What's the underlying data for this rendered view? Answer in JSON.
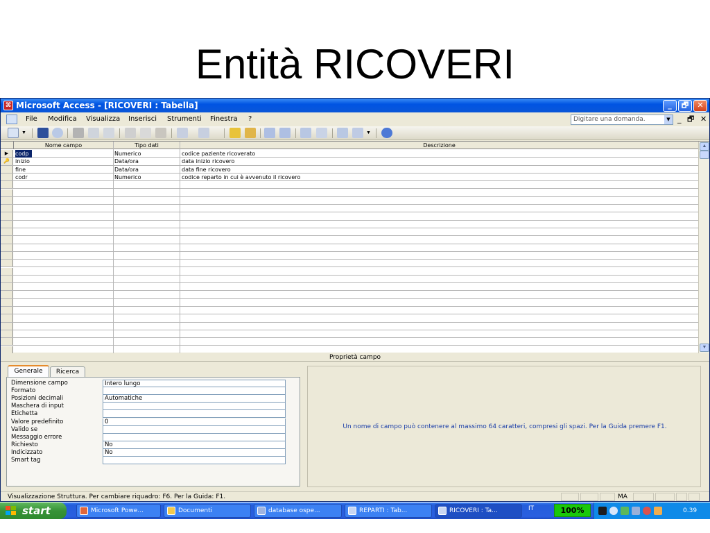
{
  "slide": {
    "title": "Entità RICOVERI"
  },
  "window": {
    "title": "Microsoft Access - [RICOVERI : Tabella]",
    "app_icon": "access-icon",
    "controls": [
      "_",
      "🗗",
      "✕"
    ]
  },
  "menubar": {
    "items": [
      "File",
      "Modifica",
      "Visualizza",
      "Inserisci",
      "Strumenti",
      "Finestra",
      "?"
    ],
    "help_placeholder": "Digitare una domanda.",
    "mdi_controls": [
      "_",
      "🗗",
      "✕"
    ]
  },
  "toolbar": {
    "icons": [
      "view-icon",
      "save-icon",
      "search-icon",
      "print-icon",
      "print-preview-icon",
      "spelling-icon",
      "cut-icon",
      "copy-icon",
      "paste-icon",
      "undo-icon",
      "redo-icon",
      "primary-key-icon",
      "indexes-icon",
      "insert-rows-icon",
      "delete-rows-icon",
      "properties-icon",
      "build-icon",
      "database-window-icon",
      "new-object-icon",
      "help-icon"
    ]
  },
  "grid": {
    "headers": [
      "Nome campo",
      "Tipo dati",
      "Descrizione"
    ],
    "rows": [
      {
        "selector": "▶",
        "name": "codp",
        "type": "Numerico",
        "description": "codice paziente ricoverato"
      },
      {
        "selector": "🔑",
        "name": "inizio",
        "type": "Data/ora",
        "description": "data inizio ricovero"
      },
      {
        "selector": "",
        "name": "fine",
        "type": "Data/ora",
        "description": "data fine ricovero"
      },
      {
        "selector": "",
        "name": "codr",
        "type": "Numerico",
        "description": "codice reparto in cui è avvenuto il ricovero"
      }
    ]
  },
  "properties": {
    "caption": "Proprietà campo",
    "tabs": [
      "Generale",
      "Ricerca"
    ],
    "fields": [
      {
        "label": "Dimensione campo",
        "value": "Intero lungo"
      },
      {
        "label": "Formato",
        "value": ""
      },
      {
        "label": "Posizioni decimali",
        "value": "Automatiche"
      },
      {
        "label": "Maschera di input",
        "value": ""
      },
      {
        "label": "Etichetta",
        "value": ""
      },
      {
        "label": "Valore predefinito",
        "value": "0"
      },
      {
        "label": "Valido se",
        "value": ""
      },
      {
        "label": "Messaggio errore",
        "value": ""
      },
      {
        "label": "Richiesto",
        "value": "No"
      },
      {
        "label": "Indicizzato",
        "value": "No"
      },
      {
        "label": "Smart tag",
        "value": ""
      }
    ],
    "hint": "Un nome di campo può contenere al massimo 64 caratteri, compresi gli spazi. Per la Guida premere F1."
  },
  "statusbar": {
    "text": "Visualizzazione Struttura. Per cambiare riquadro: F6. Per la Guida: F1.",
    "indicator": "MA"
  },
  "taskbar": {
    "start": "start",
    "tasks": [
      {
        "label": "Microsoft Powe...",
        "icon": "powerpoint-icon"
      },
      {
        "label": "Documenti",
        "icon": "folder-icon"
      },
      {
        "label": "database ospe...",
        "icon": "database-icon"
      },
      {
        "label": "REPARTI : Tab...",
        "icon": "table-icon"
      },
      {
        "label": "RICOVERI : Ta...",
        "icon": "table-icon"
      }
    ],
    "language": "IT",
    "zoom": "100%",
    "clock": "0.39"
  },
  "colors": {
    "titlebar": "#0054e3",
    "taskbar": "#245edb",
    "start_button": "#379237",
    "hint_text": "#1a3ea8",
    "zoom_badge": "#19c80a"
  }
}
